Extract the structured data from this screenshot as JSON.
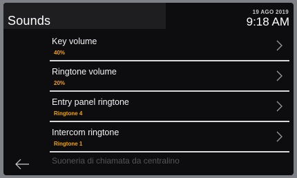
{
  "header": {
    "title": "Sounds",
    "date": "19 AGO 2019",
    "time": "9:18 AM"
  },
  "items": [
    {
      "label": "Key volume",
      "value": "40%"
    },
    {
      "label": "Ringtone volume",
      "value": "20%"
    },
    {
      "label": "Entry panel ringtone",
      "value": "Ringtone 4"
    },
    {
      "label": "Intercom ringtone",
      "value": "Ringtone 1"
    },
    {
      "label": "Suoneria di chiamata da centralino",
      "value": ""
    }
  ],
  "icons": {
    "chevron": "chevron-right-icon",
    "back": "back-arrow-icon"
  },
  "colors": {
    "background": "#0d0d0f",
    "title_bar": "#1e1e20",
    "accent": "#f5a400",
    "divider": "#dadada"
  }
}
